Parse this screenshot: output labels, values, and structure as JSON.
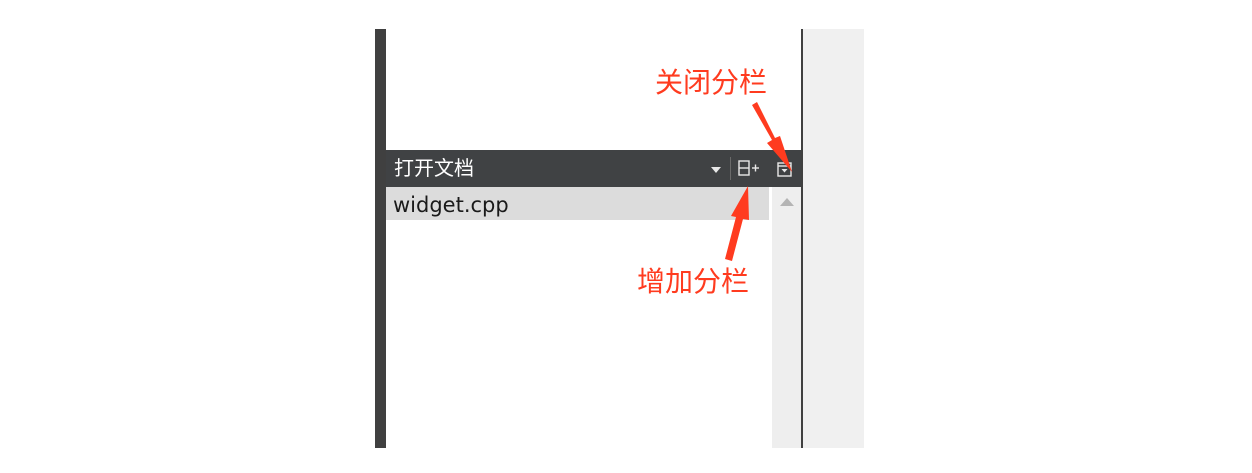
{
  "open_documents": {
    "title": "打开文档",
    "items": [
      {
        "label": "widget.cpp"
      }
    ]
  },
  "annotations": {
    "close_split": "关闭分栏",
    "add_split": "增加分栏"
  },
  "icons": {
    "dropdown": "dropdown-arrow-icon",
    "split": "split-add-icon",
    "close_split": "close-split-icon",
    "scroll_up": "scroll-up-icon"
  },
  "colors": {
    "header_bg": "#404244",
    "annotation": "#ff3b1f",
    "selected_row": "#dcdcdc"
  }
}
